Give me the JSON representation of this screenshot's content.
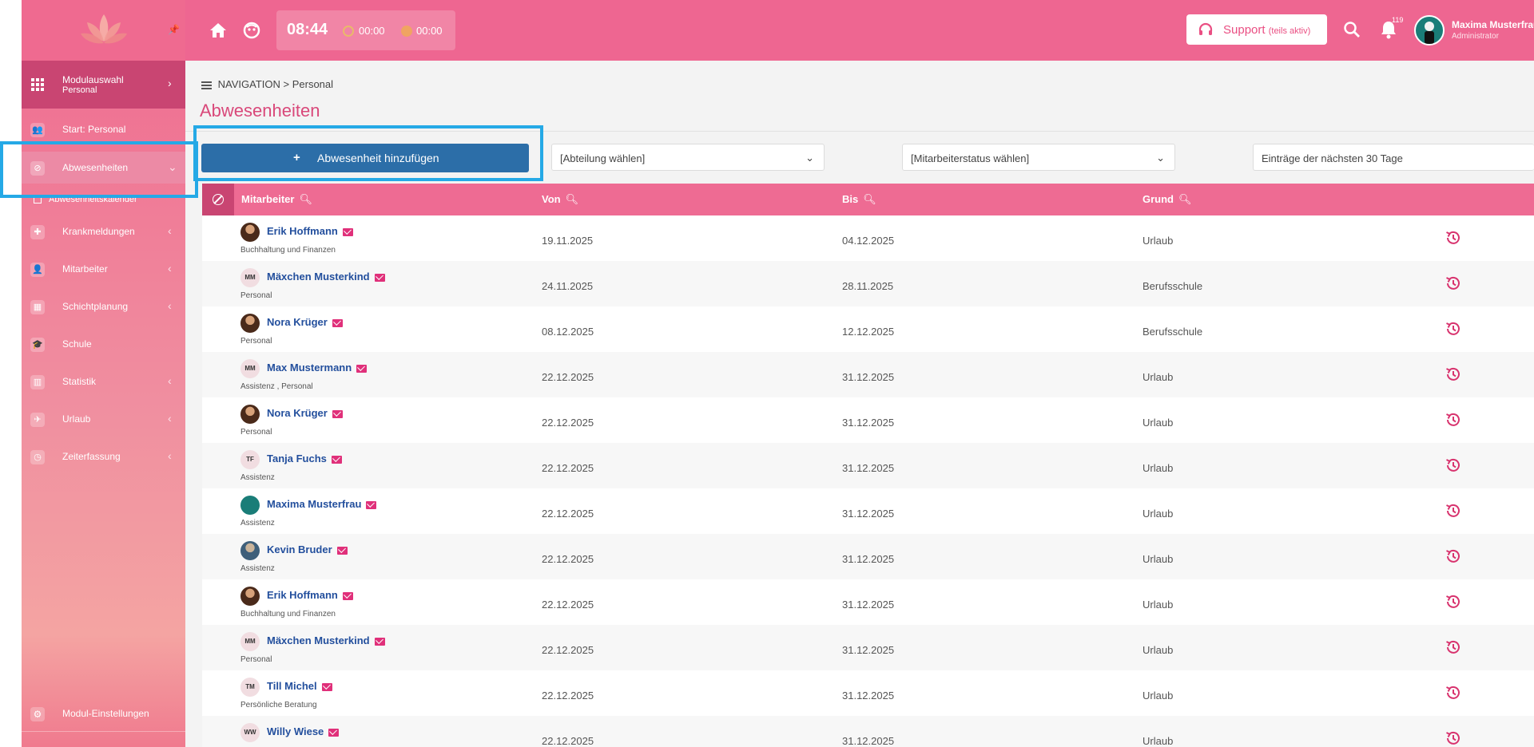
{
  "sidebar": {
    "pin_icon": "pin-icon",
    "module": {
      "title": "Modulauswahl",
      "subtitle": "Personal"
    },
    "items": [
      {
        "label": "Start: Personal",
        "icon": "people-icon"
      },
      {
        "label": "Abwesenheiten",
        "icon": "ban-icon"
      },
      {
        "label": "Abwesenheitskalender",
        "icon": "calendar-icon"
      },
      {
        "label": "Krankmeldungen",
        "icon": "medical-icon"
      },
      {
        "label": "Mitarbeiter",
        "icon": "user-icon"
      },
      {
        "label": "Schichtplanung",
        "icon": "schedule-icon"
      },
      {
        "label": "Schule",
        "icon": "school-icon"
      },
      {
        "label": "Statistik",
        "icon": "chart-icon"
      },
      {
        "label": "Urlaub",
        "icon": "plane-icon"
      },
      {
        "label": "Zeiterfassung",
        "icon": "clock-icon"
      }
    ],
    "bottom": {
      "label": "Modul-Einstellungen",
      "icon": "gear-icon"
    },
    "arrow_open": "⌄",
    "arrow_closed": "‹",
    "arrow_right": "›"
  },
  "topbar": {
    "clock": "08:44",
    "timer1": "00:00",
    "timer2": "00:00",
    "support_label": "Support",
    "support_note": "(teils aktiv)",
    "notification_count": "119",
    "user_name": "Maxima Musterfrau",
    "user_role": "Administrator"
  },
  "content": {
    "breadcrumb_nav": "NAVIGATION",
    "breadcrumb_sep": ">",
    "breadcrumb_current": "Personal",
    "page_title": "Abwesenheiten",
    "add_button": "Abwesenheit hinzufügen",
    "add_plus": "+",
    "filter_department": "[Abteilung wählen]",
    "filter_status": "[Mitarbeiterstatus wählen]",
    "filter_range": "Einträge der nächsten 30 Tage"
  },
  "table": {
    "columns": [
      "Mitarbeiter",
      "Von",
      "Bis",
      "Grund"
    ],
    "rows": [
      {
        "name": "Erik Hoffmann",
        "initials": "",
        "avatar": "photo",
        "dept": "Buchhaltung und Finanzen",
        "from": "19.11.2025",
        "to": "04.12.2025",
        "reason": "Urlaub"
      },
      {
        "name": "Mäxchen Musterkind",
        "initials": "MM",
        "avatar": "initials",
        "dept": "Personal",
        "from": "24.11.2025",
        "to": "28.11.2025",
        "reason": "Berufsschule"
      },
      {
        "name": "Nora Krüger",
        "initials": "",
        "avatar": "photo",
        "dept": "Personal",
        "from": "08.12.2025",
        "to": "12.12.2025",
        "reason": "Berufsschule"
      },
      {
        "name": "Max Mustermann",
        "initials": "MM",
        "avatar": "initials",
        "dept": "Assistenz , Personal",
        "from": "22.12.2025",
        "to": "31.12.2025",
        "reason": "Urlaub"
      },
      {
        "name": "Nora Krüger",
        "initials": "",
        "avatar": "photo",
        "dept": "Personal",
        "from": "22.12.2025",
        "to": "31.12.2025",
        "reason": "Urlaub"
      },
      {
        "name": "Tanja Fuchs",
        "initials": "TF",
        "avatar": "initials",
        "dept": "Assistenz",
        "from": "22.12.2025",
        "to": "31.12.2025",
        "reason": "Urlaub"
      },
      {
        "name": "Maxima Musterfrau",
        "initials": "",
        "avatar": "teal",
        "dept": "Assistenz",
        "from": "22.12.2025",
        "to": "31.12.2025",
        "reason": "Urlaub"
      },
      {
        "name": "Kevin Bruder",
        "initials": "",
        "avatar": "blue",
        "dept": "Assistenz",
        "from": "22.12.2025",
        "to": "31.12.2025",
        "reason": "Urlaub"
      },
      {
        "name": "Erik Hoffmann",
        "initials": "",
        "avatar": "photo",
        "dept": "Buchhaltung und Finanzen",
        "from": "22.12.2025",
        "to": "31.12.2025",
        "reason": "Urlaub"
      },
      {
        "name": "Mäxchen Musterkind",
        "initials": "MM",
        "avatar": "initials",
        "dept": "Personal",
        "from": "22.12.2025",
        "to": "31.12.2025",
        "reason": "Urlaub"
      },
      {
        "name": "Till Michel",
        "initials": "TM",
        "avatar": "initials",
        "dept": "Persönliche Beratung",
        "from": "22.12.2025",
        "to": "31.12.2025",
        "reason": "Urlaub"
      },
      {
        "name": "Willy Wiese",
        "initials": "WW",
        "avatar": "initials",
        "dept": "",
        "from": "22.12.2025",
        "to": "31.12.2025",
        "reason": "Urlaub"
      }
    ]
  },
  "colors": {
    "brand_pink": "#ee6691",
    "sidebar_dark": "#c94572",
    "primary_button": "#2c6ea8",
    "highlight": "#25a9e6",
    "link_blue": "#234f9d"
  }
}
